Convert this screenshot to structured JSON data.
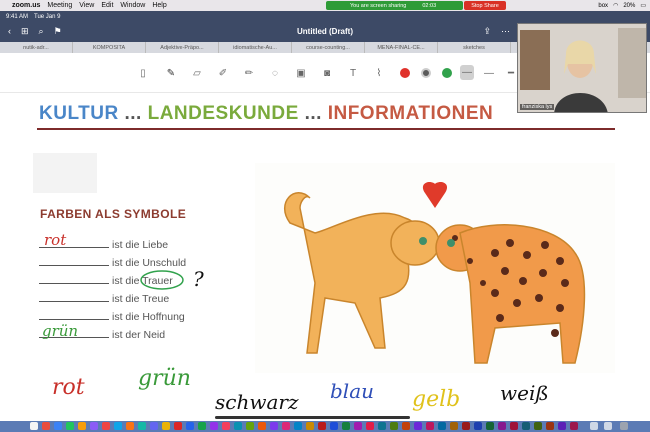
{
  "menubar": {
    "app": "zoom.us",
    "items": [
      "Meeting",
      "View",
      "Edit",
      "Window",
      "Help"
    ],
    "share_status": "You are screen sharing",
    "share_time": "02:03",
    "stop_share": "Stop Share",
    "battery": "20%",
    "box_label": "box"
  },
  "statusbar": {
    "time": "9:41 AM",
    "date": "Tue Jan 9"
  },
  "navbar": {
    "title": "Untitled (Draft)"
  },
  "tabs": [
    "nutik-adr...",
    "KOMPOSITA",
    "Adjektive-Präpo...",
    "idiomatische-Au...",
    "course-counting...",
    "MENA-FINAL-CE...",
    "sketches",
    "..."
  ],
  "toolbar": {
    "icons": [
      "page-icon",
      "pen-icon",
      "eraser-icon",
      "highlighter-icon",
      "pencil-icon",
      "lasso-icon",
      "image-icon",
      "text-icon",
      "marker-icon"
    ],
    "colors": [
      "#e0312b",
      "#5a5a5a",
      "#31a24c"
    ]
  },
  "page": {
    "heading_kultur": "KULTUR",
    "heading_dots1": "...",
    "heading_landeskunde": "LANDESKUNDE",
    "heading_dots2": "...",
    "heading_informationen": "INFORMATIONEN",
    "section_title": "FARBEN ALS SYMBOLE",
    "rows": [
      {
        "text": "ist die Liebe",
        "handwritten": "rot",
        "hw_color": "#c8302a"
      },
      {
        "text": "ist die Unschuld",
        "handwritten": "",
        "hw_color": ""
      },
      {
        "text": "ist die Trauer",
        "handwritten": "",
        "hw_color": ""
      },
      {
        "text": "ist die Treue",
        "handwritten": "",
        "hw_color": ""
      },
      {
        "text": "ist die Hoffnung",
        "handwritten": "",
        "hw_color": ""
      },
      {
        "text": "ist der Neid",
        "handwritten": "grün",
        "hw_color": "#3a9a3a"
      }
    ],
    "question_mark": "?",
    "words": [
      {
        "text": "rot",
        "color": "#c8302a"
      },
      {
        "text": "grün",
        "color": "#3a9a3a"
      },
      {
        "text": "schwarz",
        "color": "#111111"
      },
      {
        "text": "blau",
        "color": "#2f4fb8"
      },
      {
        "text": "gelb",
        "color": "#e0c21c"
      },
      {
        "text": "weiß",
        "color": "#111111"
      }
    ]
  },
  "video": {
    "name": "franziska lys"
  }
}
